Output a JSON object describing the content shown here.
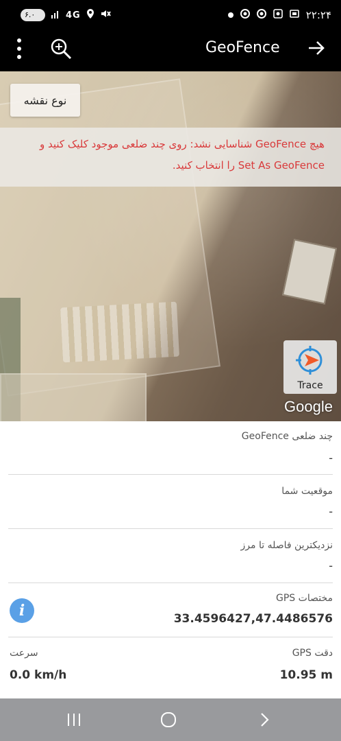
{
  "status_bar": {
    "pill_text": "۶.۰",
    "signal_text": "4G",
    "time": "۲۲:۲۴"
  },
  "app_bar": {
    "title": "GeoFence",
    "icons": [
      "more-vert-icon",
      "zoom-in-icon",
      "arrow-right-icon"
    ]
  },
  "map": {
    "map_type_button": "نوع نقشه",
    "notice_line1": "هیچ GeoFence شناسایی نشد: روی چند ضلعی موجود کلیک کنید و",
    "notice_line2": "Set As GeoFence را انتخاب کنید.",
    "trace_label": "Trace",
    "attribution": "Google",
    "notice_color": "#d9393a"
  },
  "panel": {
    "geofence_label": "چند ضلعی GeoFence",
    "geofence_value": "-",
    "location_label": "موقعیت شما",
    "location_value": "-",
    "distance_label": "نزدیکترین فاصله تا مرز",
    "distance_value": "-",
    "gps_coords_label": "مختصات GPS",
    "gps_coords_value": "33.4596427,47.4486576",
    "speed_label": "سرعت",
    "speed_value": "0.0 km/h",
    "gps_accuracy_label": "دقت GPS",
    "gps_accuracy_value": "10.95 m",
    "info_icon_glyph": "i"
  },
  "nav_bar": {
    "icons": [
      "recent-apps-icon",
      "home-icon",
      "back-icon"
    ]
  }
}
